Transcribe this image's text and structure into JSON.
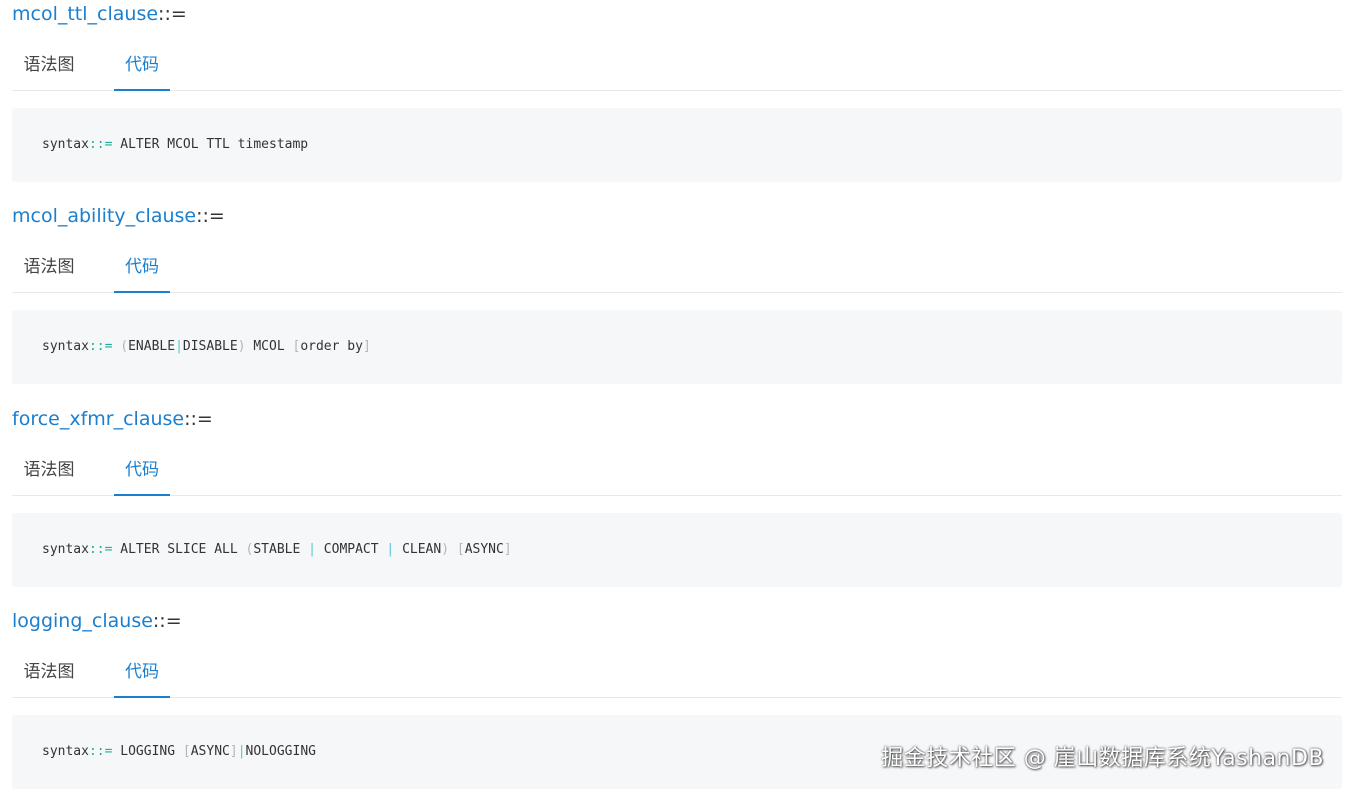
{
  "colors": {
    "link": "#1b7fcf",
    "code_bg": "#f6f7f9",
    "operator": "#1eae9a",
    "bracket": "#b5b5b5",
    "pipe": "#59c4d6"
  },
  "sections": [
    {
      "name": "mcol_ttl_clause",
      "op": "::=",
      "tabs": [
        "语法图",
        "代码"
      ],
      "code": [
        "syntax",
        "::=",
        " ALTER MCOL TTL timestamp"
      ]
    },
    {
      "name": "mcol_ability_clause",
      "op": "::=",
      "tabs": [
        "语法图",
        "代码"
      ],
      "code": [
        "syntax",
        "::=",
        " ",
        "(",
        "ENABLE",
        "|",
        "DISABLE",
        ")",
        " MCOL ",
        "[",
        "order by",
        "]"
      ]
    },
    {
      "name": "force_xfmr_clause",
      "op": "::=",
      "tabs": [
        "语法图",
        "代码"
      ],
      "code": [
        "syntax",
        "::=",
        " ALTER SLICE ALL ",
        "(",
        "STABLE ",
        "|",
        " COMPACT ",
        "|",
        " CLEAN",
        ")",
        " ",
        "[",
        "ASYNC",
        "]"
      ]
    },
    {
      "name": "logging_clause",
      "op": "::=",
      "tabs": [
        "语法图",
        "代码"
      ],
      "code": [
        "syntax",
        "::=",
        " LOGGING ",
        "[",
        "ASYNC",
        "]",
        "|",
        "NOLOGGING"
      ]
    }
  ],
  "watermark": "掘金技术社区 @ 崖山数据库系统YashanDB"
}
